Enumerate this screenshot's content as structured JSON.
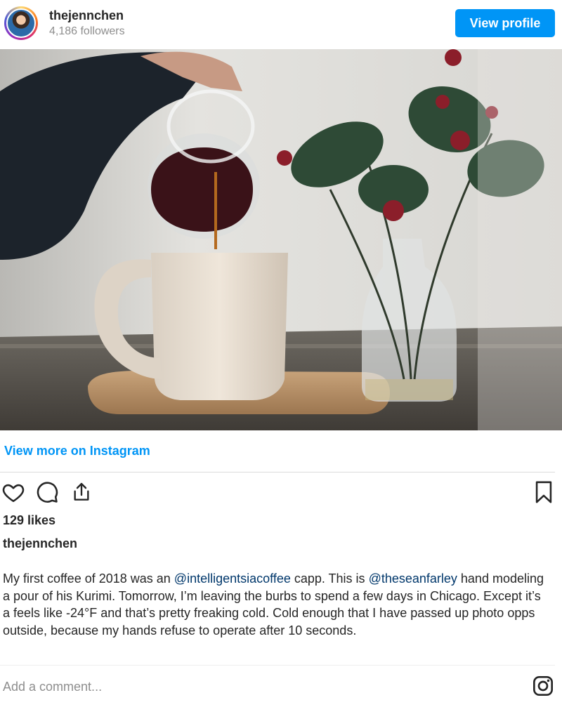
{
  "header": {
    "username": "thejennchen",
    "followers": "4,186 followers",
    "view_profile_label": "View profile"
  },
  "link": {
    "view_more": "View more on Instagram"
  },
  "post": {
    "likes": "129 likes",
    "caption_user": "thejennchen",
    "caption": {
      "part1": "My first coffee of 2018 was an ",
      "mention1": "@intelligentsiacoffee",
      "part2": " capp. This is ",
      "mention2": "@theseanfarley",
      "part3": " hand modeling a pour of his Kurimi. Tomorrow, I’m leaving the burbs to spend a few days in Chicago. Except it’s a feels like -24°F and that’s pretty freaking cold. Cold enough that I have passed up photo opps outside, because my hands refuse to operate after 10 seconds."
    }
  },
  "comment": {
    "placeholder": "Add a comment..."
  },
  "icons": [
    "heart-icon",
    "comment-icon",
    "share-icon",
    "bookmark-icon",
    "instagram-icon"
  ],
  "colors": {
    "accent": "#0095f6",
    "mention": "#00376b",
    "text": "#262626",
    "muted": "#8e8e8e"
  }
}
